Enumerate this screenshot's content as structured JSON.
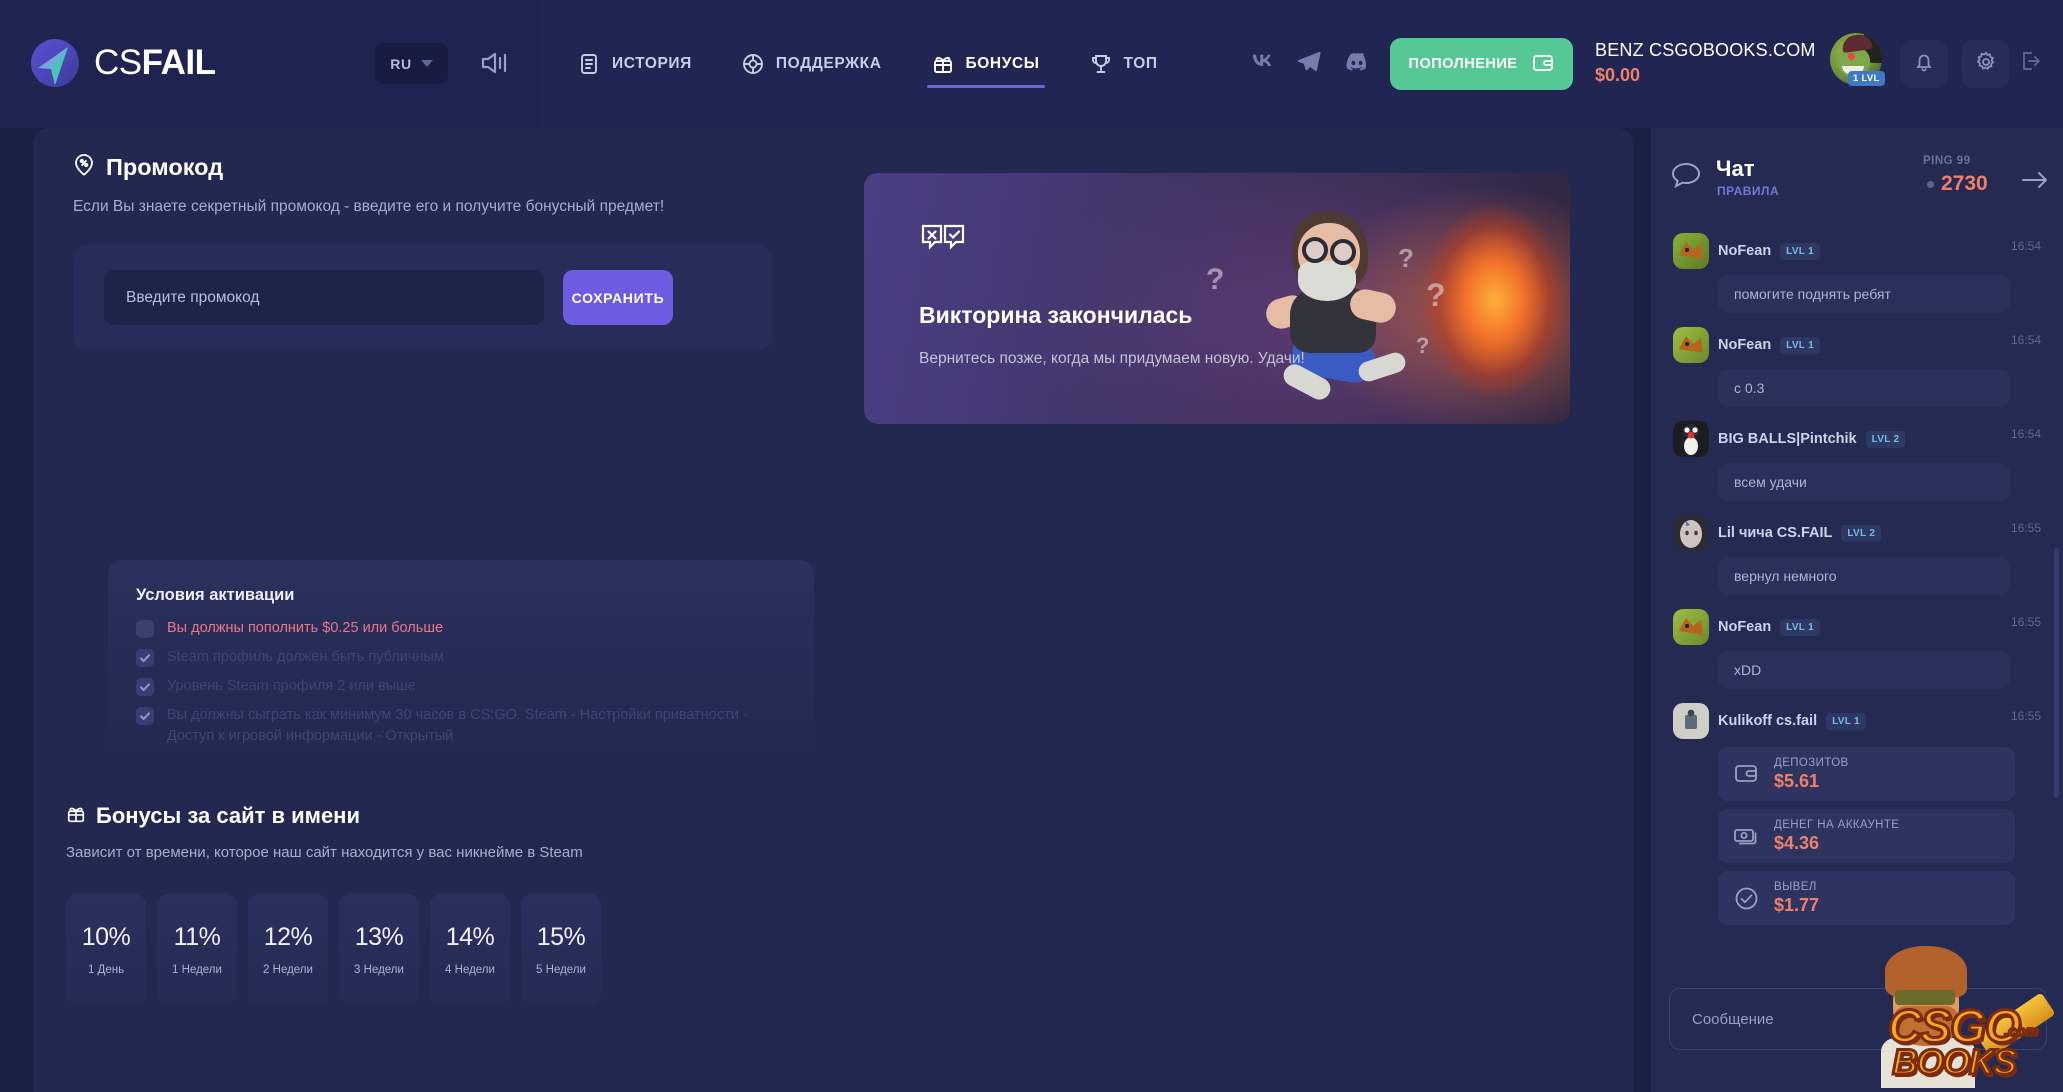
{
  "header": {
    "logo_text_light": "CS",
    "logo_text_bold": "FAIL",
    "language": "RU",
    "nav": [
      {
        "label": "ИСТОРИЯ",
        "icon": "document-icon",
        "active": false
      },
      {
        "label": "ПОДДЕРЖКА",
        "icon": "lifebuoy-icon",
        "active": false
      },
      {
        "label": "БОНУСЫ",
        "icon": "gift-icon",
        "active": true
      },
      {
        "label": "ТОП",
        "icon": "trophy-icon",
        "active": false
      }
    ],
    "socials": [
      "vk-icon",
      "telegram-icon",
      "discord-icon"
    ],
    "topup_label": "ПОПОЛНЕНИЕ",
    "user_name": "BENZ CSGOBOOKS.COM",
    "user_balance": "$0.00",
    "user_level": "1 LVL",
    "accent_green": "#56c896",
    "accent_orange": "#f08068",
    "accent_purple": "#6c5ce0"
  },
  "promo": {
    "title": "Промокод",
    "description": "Если Вы знаете секретный промокод - введите его и получите бонусный предмет!",
    "input_placeholder": "Введите промокод",
    "input_value": "",
    "save_label": "СОХРАНИТЬ"
  },
  "conditions": {
    "title": "Условия активации",
    "items": [
      {
        "text": "Вы должны пополнить $0.25 или больше",
        "state": "warn"
      },
      {
        "text": "Steam профиль должен быть публичным",
        "state": "done"
      },
      {
        "text": "Уровень Steam профиля 2 или выше",
        "state": "done"
      },
      {
        "text": "Вы должны сыграть как минимум 30 часов в CS:GO. Steam - Настройки приватности - Доступ к игровой информации - Открытый",
        "state": "done"
      }
    ]
  },
  "name_bonus": {
    "title": "Бонусы за сайт в имени",
    "description": "Зависит от времени, которое наш сайт находится у вас никнейме в Steam",
    "cards": [
      {
        "percent": "10%",
        "period": "1 День"
      },
      {
        "percent": "11%",
        "period": "1 Недели"
      },
      {
        "percent": "12%",
        "period": "2 Недели"
      },
      {
        "percent": "13%",
        "period": "3 Недели"
      },
      {
        "percent": "14%",
        "period": "4 Недели"
      },
      {
        "percent": "15%",
        "period": "5 Недели"
      }
    ]
  },
  "quiz": {
    "title": "Викторина закончилась",
    "subtitle": "Вернитесь позже, когда мы придумаем новую. Удачи!"
  },
  "chat": {
    "title": "Чат",
    "rules_label": "ПРАВИЛА",
    "ping_label": "PING 99",
    "online_count": "2730",
    "input_placeholder": "Сообщение",
    "messages": [
      {
        "name": "NoFean",
        "level": "LVL 1",
        "time": "16:54",
        "text": "помогите поднять ребят",
        "avatar": "fox"
      },
      {
        "name": "NoFean",
        "level": "LVL 1",
        "time": "16:54",
        "text": "с 0.3",
        "avatar": "fox"
      },
      {
        "name": "BIG BALLS|Pintchik",
        "level": "LVL 2",
        "time": "16:54",
        "text": "всем удачи",
        "avatar": "penguin"
      },
      {
        "name": "Lil чича CS.FAIL",
        "level": "LVL 2",
        "time": "16:55",
        "text": "вернул немного",
        "avatar": "pale"
      },
      {
        "name": "NoFean",
        "level": "LVL 1",
        "time": "16:55",
        "text": "xDD",
        "avatar": "fox"
      },
      {
        "name": "Kulikoff cs.fail",
        "level": "LVL 1",
        "time": "16:55",
        "text": "",
        "avatar": "grey",
        "stats": [
          {
            "icon": "wallet-icon",
            "label": "ДЕПОЗИТОВ",
            "value": "$5.61"
          },
          {
            "icon": "banknote-icon",
            "label": "ДЕНЕГ НА АККАУНТЕ",
            "value": "$4.36"
          },
          {
            "icon": "check-circle-icon",
            "label": "ВЫВЕЛ",
            "value": "$1.77"
          }
        ]
      }
    ]
  },
  "watermark": {
    "line1": "CSGO",
    "line2": "BOOKS",
    "suffix": ".com"
  }
}
